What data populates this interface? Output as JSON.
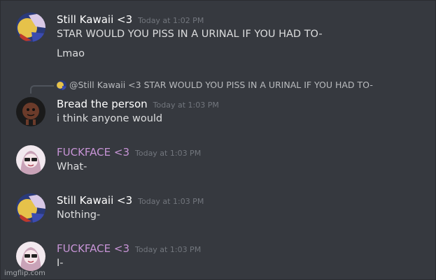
{
  "messages": [
    {
      "author": "Still Kawaii <3",
      "timestamp": "Today at 1:02 PM",
      "lines": [
        "STAR WOULD YOU PISS IN A URINAL IF YOU HAD TO-",
        "Lmao"
      ]
    },
    {
      "reply": {
        "author": "@Still Kawaii <3",
        "text": "STAR WOULD YOU PISS IN A URINAL IF YOU HAD TO-"
      },
      "author": "Bread the person",
      "timestamp": "Today at 1:03 PM",
      "lines": [
        "i think anyone would"
      ]
    },
    {
      "author": "FUCKFACE <3",
      "timestamp": "Today at 1:03 PM",
      "lines": [
        "What-"
      ]
    },
    {
      "author": "Still Kawaii <3",
      "timestamp": "Today at 1:03 PM",
      "lines": [
        "Nothing-"
      ]
    },
    {
      "author": "FUCKFACE <3",
      "timestamp": "Today at 1:03 PM",
      "lines": [
        "I-"
      ]
    }
  ],
  "colors": {
    "background": "#36393f",
    "username_default": "#ffffff",
    "username_pink": "#c794d6",
    "timestamp": "#72767d",
    "message_text": "#dcddde"
  },
  "watermark": "imgflip.com"
}
